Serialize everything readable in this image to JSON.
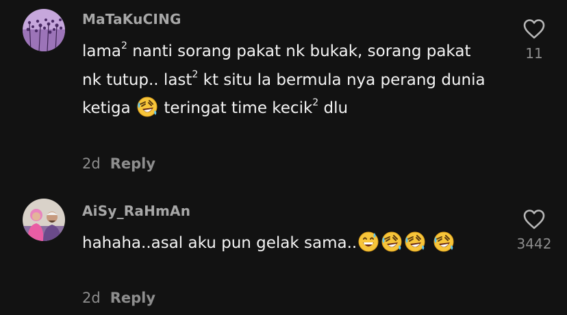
{
  "comments": [
    {
      "username": "MaTaKuCING",
      "text_parts": [
        "lama",
        "2",
        " nanti sorang pakat nk bukak, sorang pakat nk tutup.. last",
        "2",
        " kt situ la bermula nya perang dunia ketiga ",
        " teringat time kecik",
        "2",
        " dlu"
      ],
      "emojis": [
        "rofl"
      ],
      "age": "2d",
      "reply_label": "Reply",
      "likes": "11",
      "avatar_icon": "lavender-flowers-avatar"
    },
    {
      "username": "AiSy_RaHmAn",
      "text_parts": [
        "hahaha..asal aku pun gelak sama.."
      ],
      "emojis": [
        "grinning-sweat",
        "rofl",
        "rofl",
        "rofl"
      ],
      "age": "2d",
      "reply_label": "Reply",
      "likes": "3442",
      "avatar_icon": "couple-photo-avatar"
    }
  ],
  "colors": {
    "background": "#121212",
    "text": "#f4f4f4",
    "muted": "#8e8e8e",
    "username": "#a8a8a8",
    "emoji_yellow": "#f7c53a"
  }
}
